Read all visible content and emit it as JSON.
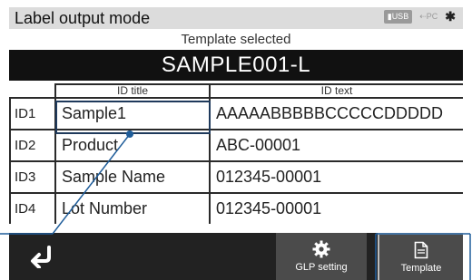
{
  "header": {
    "title": "Label output mode",
    "usb_badge": "USB",
    "pc_label": "PC",
    "bt_glyph": "✱"
  },
  "template": {
    "label": "Template selected",
    "name": "SAMPLE001-L"
  },
  "table": {
    "headers": [
      "ID title",
      "ID text"
    ],
    "rows": [
      {
        "id": "ID1",
        "title": "Sample1",
        "text": "AAAAABBBBBCCCCCDDDDD"
      },
      {
        "id": "ID2",
        "title": "Product",
        "text": "ABC-00001"
      },
      {
        "id": "ID3",
        "title": "Sample Name",
        "text": "012345-00001"
      },
      {
        "id": "ID4",
        "title": "Lot Number",
        "text": "012345-00001"
      }
    ]
  },
  "buttons": {
    "back_icon": "return-icon",
    "glp_label": "GLP setting",
    "template_label": "Template"
  },
  "colors": {
    "header_bg": "#dcdcdc",
    "bar_bg": "#222222",
    "button_bg": "#4b4b4b",
    "highlight": "#1f3a5c"
  }
}
